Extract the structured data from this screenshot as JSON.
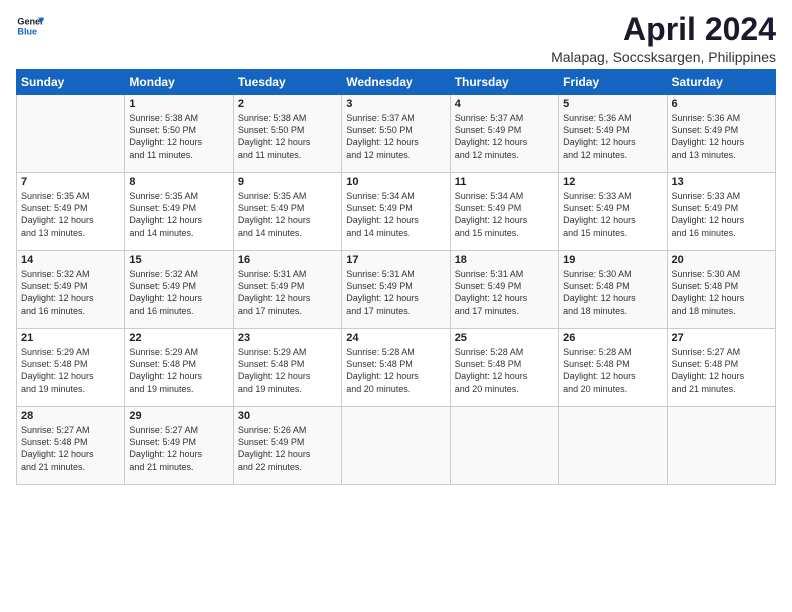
{
  "header": {
    "logo_line1": "General",
    "logo_line2": "Blue",
    "title": "April 2024",
    "subtitle": "Malapag, Soccsksargen, Philippines"
  },
  "weekdays": [
    "Sunday",
    "Monday",
    "Tuesday",
    "Wednesday",
    "Thursday",
    "Friday",
    "Saturday"
  ],
  "weeks": [
    [
      {
        "day": "",
        "info": ""
      },
      {
        "day": "1",
        "info": "Sunrise: 5:38 AM\nSunset: 5:50 PM\nDaylight: 12 hours\nand 11 minutes."
      },
      {
        "day": "2",
        "info": "Sunrise: 5:38 AM\nSunset: 5:50 PM\nDaylight: 12 hours\nand 11 minutes."
      },
      {
        "day": "3",
        "info": "Sunrise: 5:37 AM\nSunset: 5:50 PM\nDaylight: 12 hours\nand 12 minutes."
      },
      {
        "day": "4",
        "info": "Sunrise: 5:37 AM\nSunset: 5:49 PM\nDaylight: 12 hours\nand 12 minutes."
      },
      {
        "day": "5",
        "info": "Sunrise: 5:36 AM\nSunset: 5:49 PM\nDaylight: 12 hours\nand 12 minutes."
      },
      {
        "day": "6",
        "info": "Sunrise: 5:36 AM\nSunset: 5:49 PM\nDaylight: 12 hours\nand 13 minutes."
      }
    ],
    [
      {
        "day": "7",
        "info": "Sunrise: 5:35 AM\nSunset: 5:49 PM\nDaylight: 12 hours\nand 13 minutes."
      },
      {
        "day": "8",
        "info": "Sunrise: 5:35 AM\nSunset: 5:49 PM\nDaylight: 12 hours\nand 14 minutes."
      },
      {
        "day": "9",
        "info": "Sunrise: 5:35 AM\nSunset: 5:49 PM\nDaylight: 12 hours\nand 14 minutes."
      },
      {
        "day": "10",
        "info": "Sunrise: 5:34 AM\nSunset: 5:49 PM\nDaylight: 12 hours\nand 14 minutes."
      },
      {
        "day": "11",
        "info": "Sunrise: 5:34 AM\nSunset: 5:49 PM\nDaylight: 12 hours\nand 15 minutes."
      },
      {
        "day": "12",
        "info": "Sunrise: 5:33 AM\nSunset: 5:49 PM\nDaylight: 12 hours\nand 15 minutes."
      },
      {
        "day": "13",
        "info": "Sunrise: 5:33 AM\nSunset: 5:49 PM\nDaylight: 12 hours\nand 16 minutes."
      }
    ],
    [
      {
        "day": "14",
        "info": "Sunrise: 5:32 AM\nSunset: 5:49 PM\nDaylight: 12 hours\nand 16 minutes."
      },
      {
        "day": "15",
        "info": "Sunrise: 5:32 AM\nSunset: 5:49 PM\nDaylight: 12 hours\nand 16 minutes."
      },
      {
        "day": "16",
        "info": "Sunrise: 5:31 AM\nSunset: 5:49 PM\nDaylight: 12 hours\nand 17 minutes."
      },
      {
        "day": "17",
        "info": "Sunrise: 5:31 AM\nSunset: 5:49 PM\nDaylight: 12 hours\nand 17 minutes."
      },
      {
        "day": "18",
        "info": "Sunrise: 5:31 AM\nSunset: 5:49 PM\nDaylight: 12 hours\nand 17 minutes."
      },
      {
        "day": "19",
        "info": "Sunrise: 5:30 AM\nSunset: 5:48 PM\nDaylight: 12 hours\nand 18 minutes."
      },
      {
        "day": "20",
        "info": "Sunrise: 5:30 AM\nSunset: 5:48 PM\nDaylight: 12 hours\nand 18 minutes."
      }
    ],
    [
      {
        "day": "21",
        "info": "Sunrise: 5:29 AM\nSunset: 5:48 PM\nDaylight: 12 hours\nand 19 minutes."
      },
      {
        "day": "22",
        "info": "Sunrise: 5:29 AM\nSunset: 5:48 PM\nDaylight: 12 hours\nand 19 minutes."
      },
      {
        "day": "23",
        "info": "Sunrise: 5:29 AM\nSunset: 5:48 PM\nDaylight: 12 hours\nand 19 minutes."
      },
      {
        "day": "24",
        "info": "Sunrise: 5:28 AM\nSunset: 5:48 PM\nDaylight: 12 hours\nand 20 minutes."
      },
      {
        "day": "25",
        "info": "Sunrise: 5:28 AM\nSunset: 5:48 PM\nDaylight: 12 hours\nand 20 minutes."
      },
      {
        "day": "26",
        "info": "Sunrise: 5:28 AM\nSunset: 5:48 PM\nDaylight: 12 hours\nand 20 minutes."
      },
      {
        "day": "27",
        "info": "Sunrise: 5:27 AM\nSunset: 5:48 PM\nDaylight: 12 hours\nand 21 minutes."
      }
    ],
    [
      {
        "day": "28",
        "info": "Sunrise: 5:27 AM\nSunset: 5:48 PM\nDaylight: 12 hours\nand 21 minutes."
      },
      {
        "day": "29",
        "info": "Sunrise: 5:27 AM\nSunset: 5:49 PM\nDaylight: 12 hours\nand 21 minutes."
      },
      {
        "day": "30",
        "info": "Sunrise: 5:26 AM\nSunset: 5:49 PM\nDaylight: 12 hours\nand 22 minutes."
      },
      {
        "day": "",
        "info": ""
      },
      {
        "day": "",
        "info": ""
      },
      {
        "day": "",
        "info": ""
      },
      {
        "day": "",
        "info": ""
      }
    ]
  ]
}
